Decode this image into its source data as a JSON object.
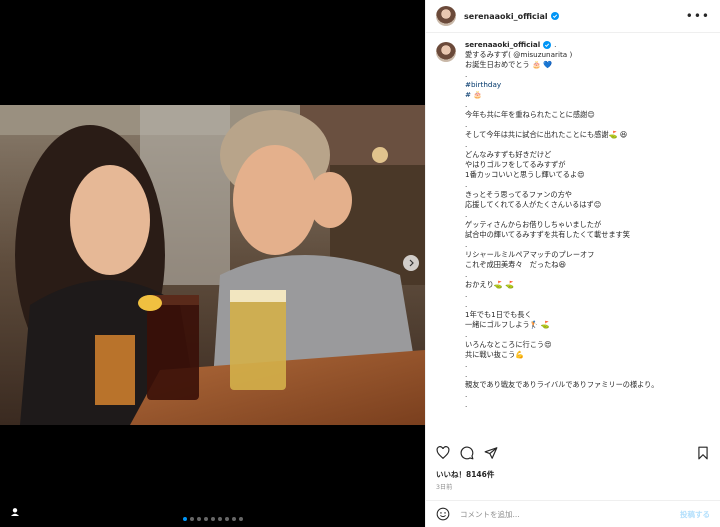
{
  "post": {
    "username": "serenaaoki_official",
    "likes_text": "いいね！8146件",
    "date_text": "3日前"
  },
  "caption": {
    "header_suffix": ".",
    "lines": [
      {
        "text": "愛するみすず( @misuzunarita )",
        "type": "text"
      },
      {
        "text": "お誕生日おめでとう 🎂 💙",
        "type": "text"
      },
      {
        "text": ".",
        "type": "text"
      },
      {
        "text": "#birthday",
        "type": "tag"
      },
      {
        "text": "# 🎂",
        "type": "tag"
      },
      {
        "text": ".",
        "type": "text"
      },
      {
        "text": "今年も共に年を重ねられたことに感謝😊",
        "type": "text"
      },
      {
        "text": ".",
        "type": "text"
      },
      {
        "text": "そして今年は共に試合に出れたことにも感謝⛳ 😆",
        "type": "text"
      },
      {
        "text": ".",
        "type": "text"
      },
      {
        "text": "どんなみすずも好きだけど",
        "type": "text"
      },
      {
        "text": "やはりゴルフをしてるみすずが",
        "type": "text"
      },
      {
        "text": "1番カッコいいと思うし輝いてるよ😍",
        "type": "text"
      },
      {
        "text": ".",
        "type": "text"
      },
      {
        "text": "きっとそう思ってるファンの方や",
        "type": "text"
      },
      {
        "text": "応援してくれてる人がたくさんいるはず😊",
        "type": "text"
      },
      {
        "text": ".",
        "type": "text"
      },
      {
        "text": "ゲッティさんからお借りしちゃいましたが",
        "type": "text"
      },
      {
        "text": "試合中の輝いてるみすずを共有したくて載せます笑",
        "type": "text"
      },
      {
        "text": ".",
        "type": "text"
      },
      {
        "text": "リシャールミルペアマッチのプレーオフ",
        "type": "text"
      },
      {
        "text": "これぞ成田美寿々　だったね😆",
        "type": "text"
      },
      {
        "text": ".",
        "type": "text"
      },
      {
        "text": "おかえり⛳ ⛳",
        "type": "text"
      },
      {
        "text": ".",
        "type": "text"
      },
      {
        "text": ".",
        "type": "text"
      },
      {
        "text": "1年でも1日でも長く",
        "type": "text"
      },
      {
        "text": "一緒にゴルフしよう🏌 ⛳",
        "type": "text"
      },
      {
        "text": ".",
        "type": "text"
      },
      {
        "text": "いろんなところに行こう😍",
        "type": "text"
      },
      {
        "text": "共に戦い抜こう💪",
        "type": "text"
      },
      {
        "text": ".",
        "type": "text"
      },
      {
        "text": ".",
        "type": "text"
      },
      {
        "text": "親友であり戦友でありライバルでありファミリーの様より。",
        "type": "text"
      },
      {
        "text": ".",
        "type": "text"
      },
      {
        "text": ".",
        "type": "text"
      }
    ]
  },
  "comment": {
    "placeholder": "コメントを追加...",
    "post_label": "投稿する"
  },
  "carousel": {
    "count": 9,
    "active_index": 0
  },
  "colors": {
    "accent": "#0095f6",
    "verified": "#0095f6",
    "hashtag": "#00376b",
    "post_disabled": "#b2dffc"
  },
  "icons": [
    "heart-icon",
    "comment-icon",
    "share-icon",
    "bookmark-icon",
    "more-icon",
    "emoji-icon",
    "user-tag-icon",
    "chevron-right-icon",
    "verified-icon"
  ]
}
